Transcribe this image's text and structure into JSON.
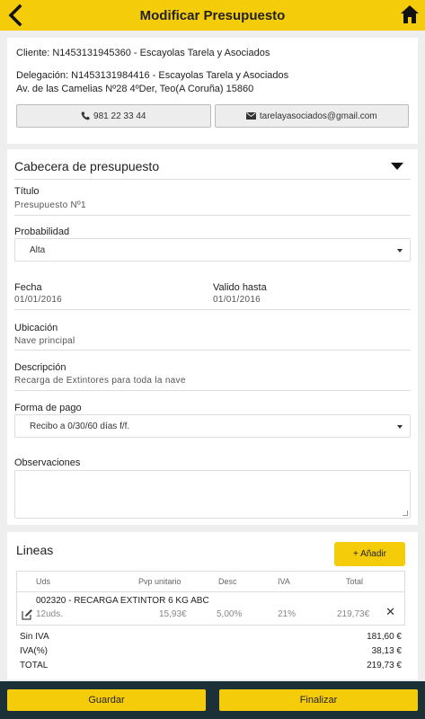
{
  "header": {
    "title": "Modificar Presupuesto",
    "back_icon": "chevron-left-icon",
    "home_icon": "home-icon",
    "bar_color": "#f5cc0a"
  },
  "client": {
    "cliente_label": "Cliente:",
    "cliente_value": "N1453131945360 - Escayolas Tarela y Asociados",
    "delegacion_label": "Delegación:",
    "delegacion_value": "N1453131984416 - Escayolas Tarela y Asociados",
    "address": "Av. de las Camelias Nº28 4ºDer, Teo(A Coruña) 15860",
    "phone": "981 22 33 44",
    "email": "tarelayasociados@gmail.com"
  },
  "form": {
    "section_title": "Cabecera de presupuesto",
    "titulo_label": "Título",
    "titulo_value": "Presupuesto Nº1",
    "probabilidad_label": "Probabilidad",
    "probabilidad_value": "Alta",
    "fecha_label": "Fecha",
    "fecha_value": "01/01/2016",
    "valido_label": "Valido hasta",
    "valido_value": "01/01/2016",
    "ubicacion_label": "Ubicación",
    "ubicacion_value": "Nave principal",
    "descripcion_label": "Descripción",
    "descripcion_value": "Recarga de Extintores para toda la nave",
    "forma_pago_label": "Forma de pago",
    "forma_pago_value": "Recibo a 0/30/60 días f/f.",
    "observaciones_label": "Observaciones",
    "observaciones_value": ""
  },
  "lines": {
    "title": "Lineas",
    "add_label": "+ Añadir",
    "columns": [
      "Uds",
      "Pvp unitario",
      "Desc",
      "IVA",
      "Total"
    ],
    "rows": [
      {
        "description": "002320 - RECARGA EXTINTOR 6 KG ABC",
        "uds": "12uds.",
        "pvp": "15,93€",
        "desc": "5,00%",
        "iva": "21%",
        "total": "219,73€"
      }
    ],
    "totals": [
      {
        "label": "Sin IVA",
        "value": "181,60 €"
      },
      {
        "label": "IVA(%)",
        "value": "38,13 €"
      },
      {
        "label": "TOTAL",
        "value": "219,73 €"
      }
    ]
  },
  "footer": {
    "guardar_label": "Guardar",
    "finalizar_label": "Finalizar",
    "bar_color": "#1b3137"
  }
}
